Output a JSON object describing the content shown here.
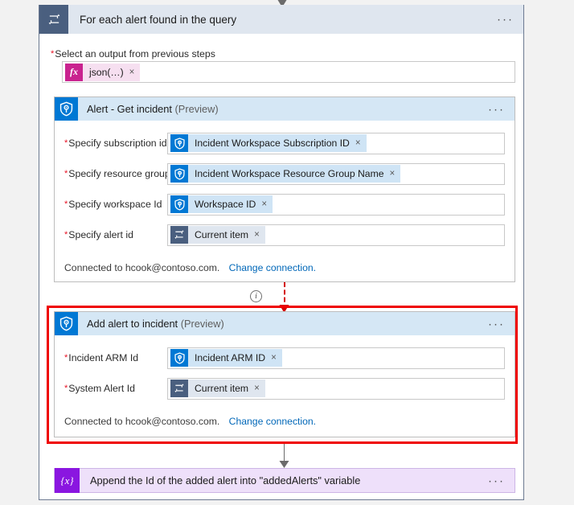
{
  "colors": {
    "sentinel_blue": "#0078d4",
    "loop_slate": "#4a5f7f",
    "fx_magenta": "#c9238f",
    "variable_purple": "#8a16e0",
    "highlight_red": "#ef0000",
    "link_blue": "#0067b8",
    "required_star_red": "#e81123",
    "card_header_blue": "#d5e7f5",
    "loop_header_blue": "#dfe6ef"
  },
  "foreach": {
    "icon": "loop-icon",
    "title": "For each alert found in the query",
    "ellipsis": "···",
    "select_output": {
      "label": "Select an output from previous steps",
      "required_marker": "*",
      "token": {
        "icon": "function-fx-icon",
        "icon_glyph": "fx",
        "label": "json(…)",
        "remove": "×"
      }
    }
  },
  "actions": [
    {
      "id": "get-incident",
      "icon": "azure-sentinel-icon",
      "title": "Alert - Get incident",
      "preview_suffix": "(Preview)",
      "ellipsis": "···",
      "fields": [
        {
          "required_marker": "*",
          "label": "Specify subscription id",
          "token": {
            "icon": "azure-sentinel-icon",
            "kind": "sentinel",
            "label": "Incident Workspace Subscription ID",
            "remove": "×"
          }
        },
        {
          "required_marker": "*",
          "label": "Specify resource group",
          "token": {
            "icon": "azure-sentinel-icon",
            "kind": "sentinel",
            "label": "Incident Workspace Resource Group Name",
            "remove": "×"
          }
        },
        {
          "required_marker": "*",
          "label": "Specify workspace Id",
          "token": {
            "icon": "azure-sentinel-icon",
            "kind": "sentinel",
            "label": "Workspace ID",
            "remove": "×"
          }
        },
        {
          "required_marker": "*",
          "label": "Specify alert id",
          "token": {
            "icon": "loop-icon",
            "kind": "current",
            "label": "Current item",
            "remove": "×"
          }
        }
      ],
      "connection": {
        "text": "Connected to hcook@contoso.com.",
        "link": "Change connection."
      }
    },
    {
      "id": "add-alert-to-incident",
      "icon": "azure-sentinel-icon",
      "title": "Add alert to incident",
      "preview_suffix": "(Preview)",
      "ellipsis": "···",
      "highlighted": true,
      "fields": [
        {
          "required_marker": "*",
          "label": "Incident ARM Id",
          "token": {
            "icon": "azure-sentinel-icon",
            "kind": "sentinel",
            "label": "Incident ARM ID",
            "remove": "×"
          }
        },
        {
          "required_marker": "*",
          "label": "System Alert Id",
          "token": {
            "icon": "loop-icon",
            "kind": "current",
            "label": "Current item",
            "remove": "×"
          }
        }
      ],
      "connection": {
        "text": "Connected to hcook@contoso.com.",
        "link": "Change connection."
      }
    }
  ],
  "connectors": {
    "info_icon_glyph": "i",
    "info_icon_name": "info-icon"
  },
  "variable_action": {
    "icon": "variable-braces-icon",
    "icon_glyph": "{x}",
    "title": "Append the Id of the added alert into \"addedAlerts\" variable",
    "ellipsis": "···"
  }
}
